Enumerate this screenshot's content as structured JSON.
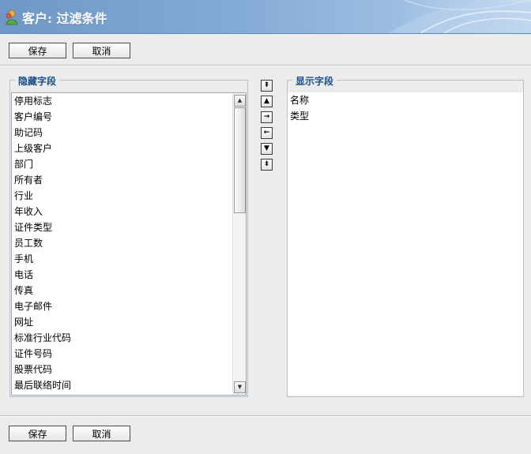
{
  "window": {
    "title": "客户: 过滤条件"
  },
  "toolbar_top": {
    "save_label": "保存",
    "cancel_label": "取消"
  },
  "toolbar_bottom": {
    "save_label": "保存",
    "cancel_label": "取消"
  },
  "hidden_fields": {
    "legend": "隐藏字段",
    "items": [
      "停用标志",
      "客户编号",
      "助记码",
      "上级客户",
      "部门",
      "所有者",
      "行业",
      "年收入",
      "证件类型",
      "员工数",
      "手机",
      "电话",
      "传真",
      "电子邮件",
      "网址",
      "标准行业代码",
      "证件号码",
      "股票代码",
      "最后联络时间"
    ]
  },
  "shown_fields": {
    "legend": "显示字段",
    "items": [
      "名称",
      "类型"
    ]
  },
  "move_buttons": [
    {
      "name": "move-top-icon",
      "glyph": "⇞"
    },
    {
      "name": "move-up-icon",
      "glyph": "▲"
    },
    {
      "name": "move-right-icon",
      "glyph": "→"
    },
    {
      "name": "move-left-icon",
      "glyph": "←"
    },
    {
      "name": "move-down-icon",
      "glyph": "▼"
    },
    {
      "name": "move-bottom-icon",
      "glyph": "⇟"
    }
  ],
  "colors": {
    "title_bar": "#7ea4d0",
    "legend_text": "#1a4f8a",
    "background": "#ececec"
  }
}
